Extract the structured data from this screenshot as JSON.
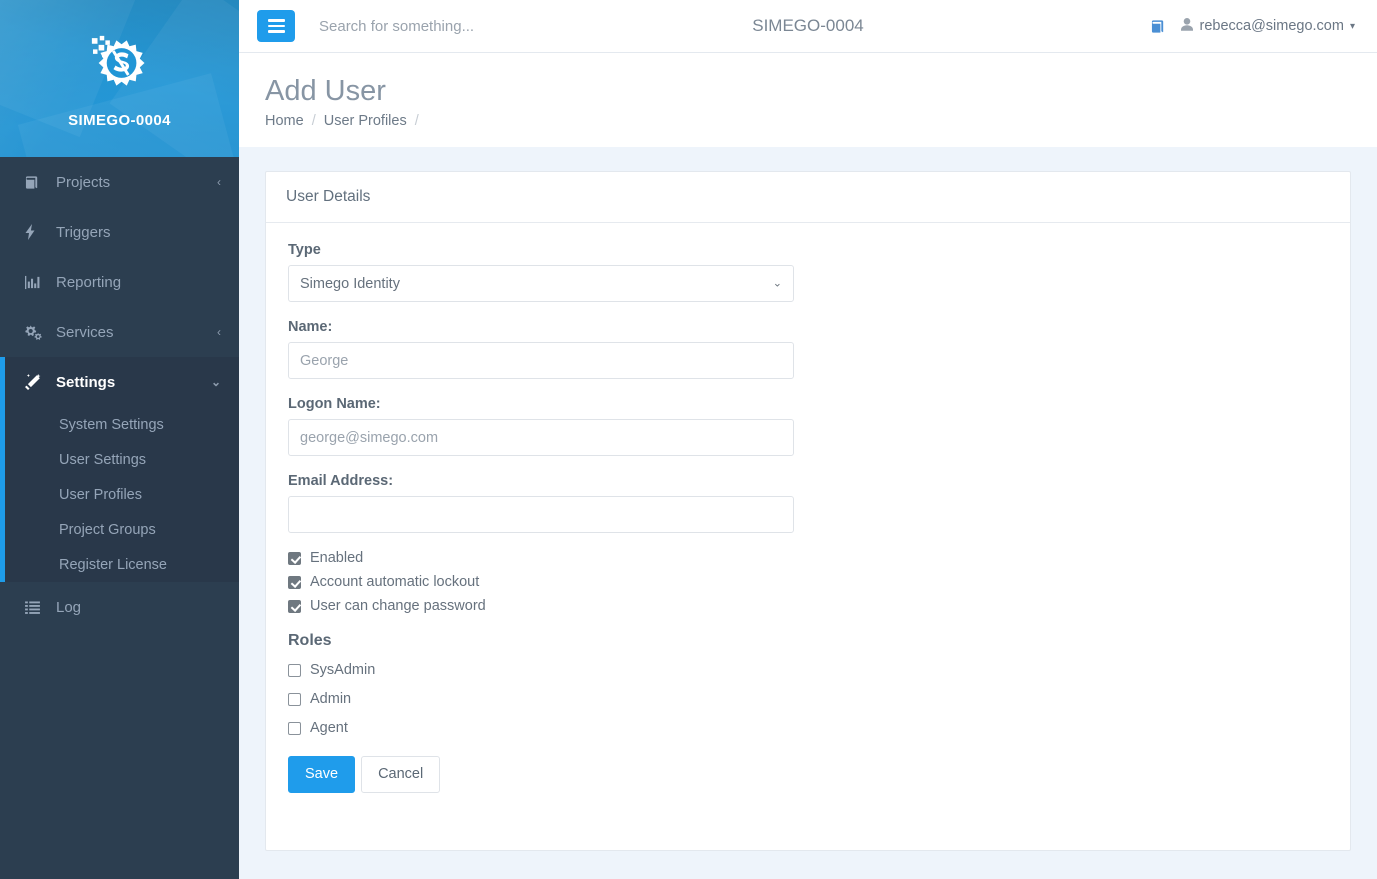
{
  "sidebar": {
    "brand": {
      "name": "SIMEGO-0004",
      "logo_icon": "gear-s-logo"
    },
    "items": [
      {
        "label": "Projects",
        "icon": "book-icon",
        "caret": "‹",
        "active": false
      },
      {
        "label": "Triggers",
        "icon": "bolt-icon",
        "caret": "",
        "active": false
      },
      {
        "label": "Reporting",
        "icon": "bar-chart-icon",
        "caret": "",
        "active": false
      },
      {
        "label": "Services",
        "icon": "cogs-icon",
        "caret": "‹",
        "active": false
      },
      {
        "label": "Settings",
        "icon": "magic-wand-icon",
        "caret": "⌄",
        "active": true
      }
    ],
    "submenu": [
      {
        "label": "System Settings"
      },
      {
        "label": "User Settings"
      },
      {
        "label": "User Profiles"
      },
      {
        "label": "Project Groups"
      },
      {
        "label": "Register License"
      }
    ],
    "footer_items": [
      {
        "label": "Log",
        "icon": "list-icon"
      }
    ]
  },
  "topbar": {
    "menu_toggle_icon": "hamburger-icon",
    "search_placeholder": "Search for something...",
    "search_value": "",
    "title": "SIMEGO-0004",
    "book_icon": "book-icon",
    "user_icon": "user-icon",
    "user_email": "rebecca@simego.com",
    "caret": "▾"
  },
  "page": {
    "title": "Add User",
    "breadcrumb": [
      {
        "label": "Home",
        "sep": "/"
      },
      {
        "label": "User Profiles",
        "sep": "/"
      }
    ]
  },
  "card": {
    "header": "User Details",
    "fields": {
      "type": {
        "label": "Type",
        "selected": "Simego Identity",
        "options": [
          "Simego Identity"
        ],
        "caret": "⌄"
      },
      "name": {
        "label": "Name:",
        "value": "",
        "placeholder": "George"
      },
      "logon_name": {
        "label": "Logon Name:",
        "value": "",
        "placeholder": "george@simego.com"
      },
      "email": {
        "label": "Email Address:",
        "value": "",
        "placeholder": ""
      }
    },
    "options": [
      {
        "label": "Enabled",
        "checked": true
      },
      {
        "label": "Account automatic lockout",
        "checked": true
      },
      {
        "label": "User can change password",
        "checked": true
      }
    ],
    "roles_title": "Roles",
    "roles": [
      {
        "label": "SysAdmin",
        "checked": false
      },
      {
        "label": "Admin",
        "checked": false
      },
      {
        "label": "Agent",
        "checked": false
      }
    ],
    "buttons": {
      "save": "Save",
      "cancel": "Cancel"
    }
  },
  "colors": {
    "accent_blue": "#1f9ceb",
    "sidebar_bg": "#2c3e50",
    "sidebar_active_bg": "#29384a",
    "brand_blue": "#2196d6",
    "page_bg": "#eef4fb"
  }
}
